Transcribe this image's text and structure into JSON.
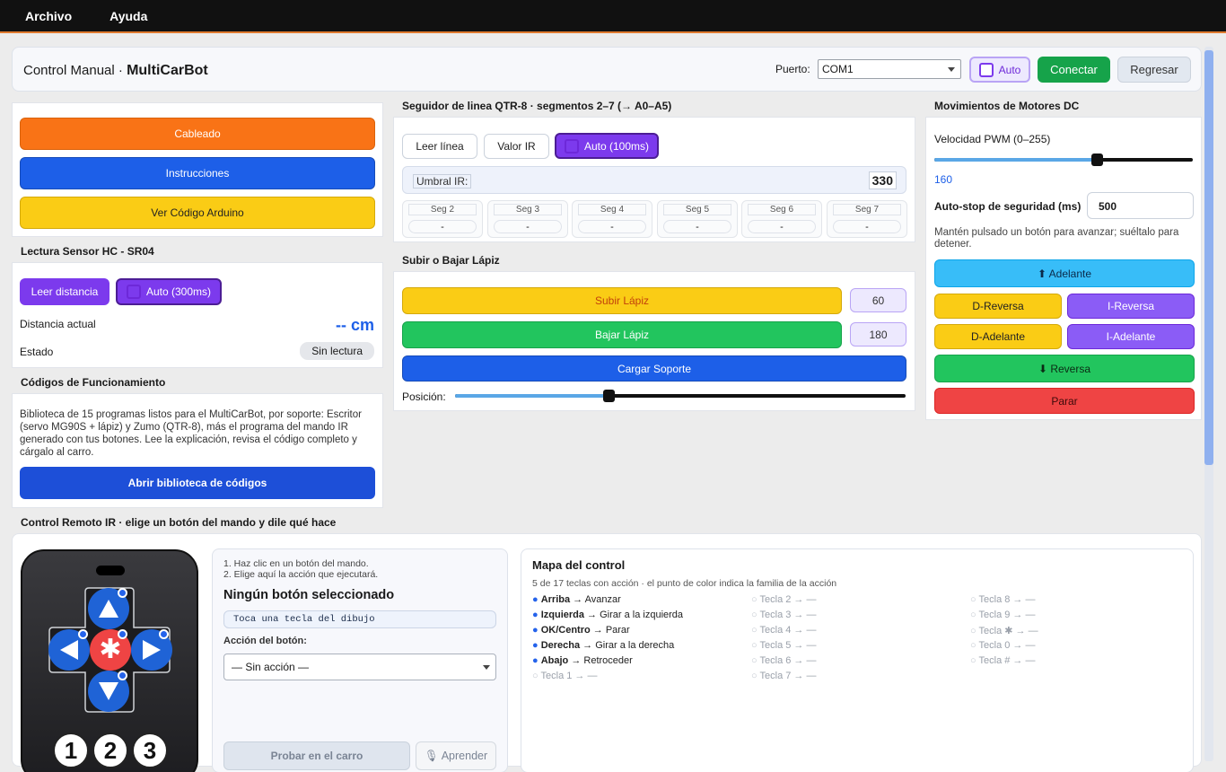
{
  "menu": {
    "items": [
      "Archivo",
      "Ayuda"
    ]
  },
  "header": {
    "title_prefix": "Control Manual ·",
    "title_app": "MultiCarBot",
    "port_label": "Puerto:",
    "port_value": "COM1",
    "auto_label": "Auto",
    "connect_label": "Conectar",
    "back_label": "Regresar"
  },
  "left": {
    "wiring": "Cableado",
    "instructions": "Instrucciones",
    "view_code": "Ver Código Arduino",
    "hc_title": "Lectura Sensor HC - SR04",
    "read_distance": "Leer distancia",
    "auto_300": "Auto (300ms)",
    "distance_label": "Distancia actual",
    "distance_value": "-- cm",
    "state_label": "Estado",
    "state_value": "Sin lectura",
    "codes_title": "Códigos de Funcionamiento",
    "codes_desc": "Biblioteca de 15 programas listos para el MultiCarBot, por soporte: Escritor (servo MG90S + lápiz) y Zumo (QTR-8), más el programa del mando IR generado con tus botones. Lee la explicación, revisa el código completo y cárgalo al carro.",
    "open_library": "Abrir biblioteca de códigos"
  },
  "qtr": {
    "title": "Seguidor de linea QTR-8 · segmentos 2–7 (→ A0–A5)",
    "read_line": "Leer línea",
    "ir_value": "Valor IR",
    "auto_100": "Auto (100ms)",
    "threshold_label": "Umbral IR:",
    "threshold_value": "330",
    "segments": [
      {
        "label": "Seg 2",
        "value": "-"
      },
      {
        "label": "Seg 3",
        "value": "-"
      },
      {
        "label": "Seg 4",
        "value": "-"
      },
      {
        "label": "Seg 5",
        "value": "-"
      },
      {
        "label": "Seg 6",
        "value": "-"
      },
      {
        "label": "Seg 7",
        "value": "-"
      }
    ]
  },
  "pen": {
    "title": "Subir o Bajar Lápiz",
    "raise": "Subir Lápiz",
    "raise_value": "60",
    "lower": "Bajar Lápiz",
    "lower_value": "180",
    "load": "Cargar Soporte",
    "position_label": "Posición:",
    "position_fraction": 0.34
  },
  "motors": {
    "title": "Movimientos de Motores DC",
    "pwm_label": "Velocidad PWM (0–255)",
    "pwm_value": "160",
    "pwm_max": 255,
    "autostop_label": "Auto-stop de seguridad (ms)",
    "autostop_value": "500",
    "hint": "Mantén pulsado un botón para avanzar; suéltalo para detener.",
    "forward": "⬆ Adelante",
    "d_reverse": "D-Reversa",
    "i_reverse": "I-Reversa",
    "d_forward": "D-Adelante",
    "i_forward": "I-Adelante",
    "reverse": "⬇ Reversa",
    "stop": "Parar"
  },
  "ir": {
    "title": "Control Remoto IR · elige un botón del mando y dile qué hace",
    "step1": "1. Haz clic en un botón del mando.",
    "step2": "2. Elige aquí la acción que ejecutará.",
    "selected": "Ningún botón seleccionado",
    "key_hint": "Toca una tecla del dibujo",
    "action_label": "Acción del botón:",
    "action_value": "— Sin acción —",
    "test": "Probar en el carro",
    "learn": "Aprender",
    "numbers": [
      "1",
      "2",
      "3"
    ],
    "map_title": "Mapa del control",
    "map_sub": "5 de 17 teclas con acción · el punto de color indica la familia de la acción",
    "map": [
      [
        {
          "key": "Arriba",
          "action": "Avanzar",
          "on": true
        },
        {
          "key": "Izquierda",
          "action": "Girar a la izquierda",
          "on": true
        },
        {
          "key": "OK/Centro",
          "action": "Parar",
          "on": true
        },
        {
          "key": "Derecha",
          "action": "Girar a la derecha",
          "on": true
        },
        {
          "key": "Abajo",
          "action": "Retroceder",
          "on": true
        },
        {
          "key": "Tecla 1",
          "action": "—",
          "on": false
        }
      ],
      [
        {
          "key": "Tecla 2",
          "action": "—",
          "on": false
        },
        {
          "key": "Tecla 3",
          "action": "—",
          "on": false
        },
        {
          "key": "Tecla 4",
          "action": "—",
          "on": false
        },
        {
          "key": "Tecla 5",
          "action": "—",
          "on": false
        },
        {
          "key": "Tecla 6",
          "action": "—",
          "on": false
        },
        {
          "key": "Tecla 7",
          "action": "—",
          "on": false
        }
      ],
      [
        {
          "key": "Tecla 8",
          "action": "—",
          "on": false
        },
        {
          "key": "Tecla 9",
          "action": "—",
          "on": false
        },
        {
          "key": "Tecla ✱",
          "action": "—",
          "on": false
        },
        {
          "key": "Tecla 0",
          "action": "—",
          "on": false
        },
        {
          "key": "Tecla #",
          "action": "—",
          "on": false
        }
      ]
    ]
  },
  "colors": {
    "orange": "#f97316",
    "blue": "#1d5fe8",
    "yellow": "#facc15",
    "purple": "#7c3aed",
    "green": "#22c55e",
    "red": "#ef4444",
    "sky": "#38bdf8",
    "accent": "#e07a2e"
  }
}
